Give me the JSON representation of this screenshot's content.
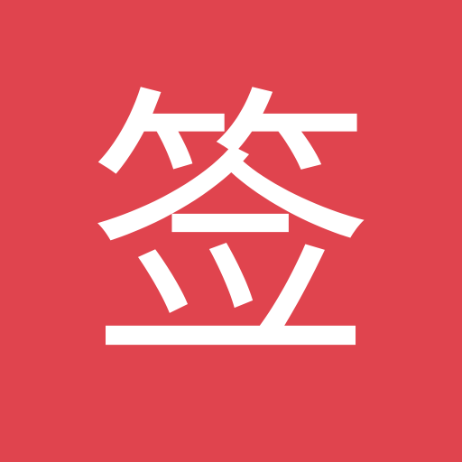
{
  "icon": {
    "glyph": "签",
    "background_color": "#E0444E",
    "glyph_color": "#FFFFFF"
  }
}
